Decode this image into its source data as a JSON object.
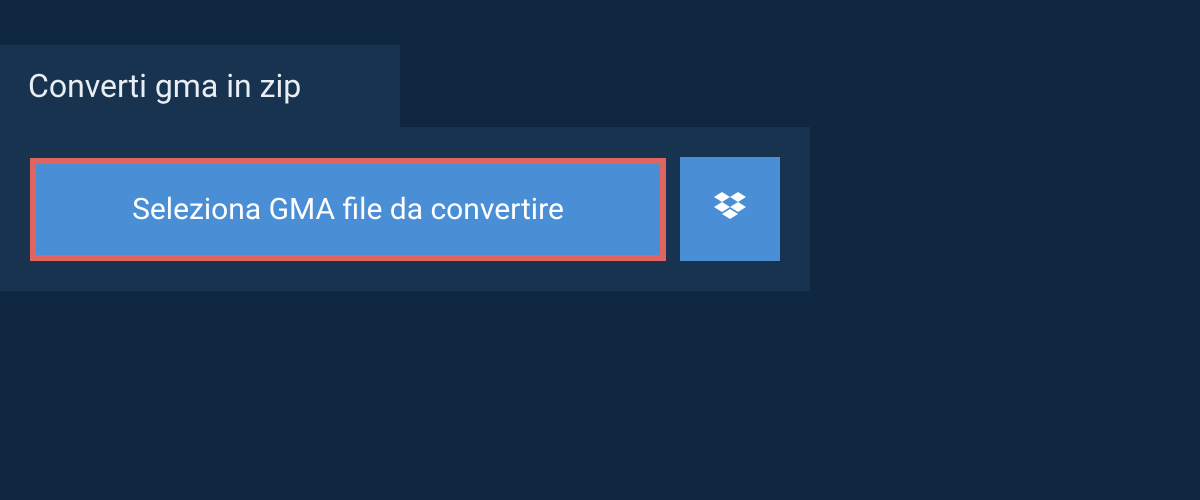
{
  "tab": {
    "title": "Converti gma in zip"
  },
  "actions": {
    "select_file_label": "Seleziona GMA file da convertire"
  }
}
